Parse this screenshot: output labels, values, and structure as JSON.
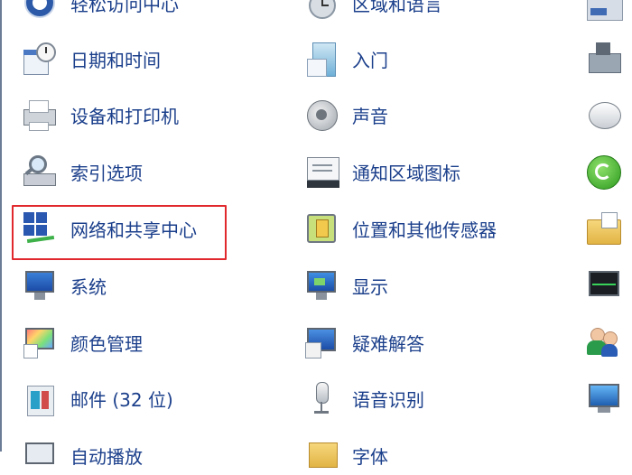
{
  "control_panel": {
    "items": [
      {
        "label": "轻松访问中心",
        "icon": "ease-of-access-icon"
      },
      {
        "label": "区域和语言",
        "icon": "region-language-icon"
      },
      {
        "label": "",
        "icon": "partial-icon-row0"
      },
      {
        "label": "日期和时间",
        "icon": "date-time-icon"
      },
      {
        "label": "入门",
        "icon": "getting-started-icon"
      },
      {
        "label": "",
        "icon": "partial-icon-row1"
      },
      {
        "label": "设备和打印机",
        "icon": "devices-printers-icon"
      },
      {
        "label": "声音",
        "icon": "sound-icon"
      },
      {
        "label": "",
        "icon": "mouse-icon"
      },
      {
        "label": "索引选项",
        "icon": "indexing-options-icon"
      },
      {
        "label": "通知区域图标",
        "icon": "notification-area-icon"
      },
      {
        "label": "",
        "icon": "sync-center-icon"
      },
      {
        "label": "网络和共享中心",
        "icon": "network-sharing-icon"
      },
      {
        "label": "位置和其他传感器",
        "icon": "location-sensors-icon"
      },
      {
        "label": "",
        "icon": "folder-options-icon"
      },
      {
        "label": "系统",
        "icon": "system-icon"
      },
      {
        "label": "显示",
        "icon": "display-icon"
      },
      {
        "label": "",
        "icon": "performance-icon"
      },
      {
        "label": "颜色管理",
        "icon": "color-management-icon"
      },
      {
        "label": "疑难解答",
        "icon": "troubleshooting-icon"
      },
      {
        "label": "",
        "icon": "user-accounts-icon"
      },
      {
        "label": "邮件 (32 位)",
        "icon": "mail-icon"
      },
      {
        "label": "语音识别",
        "icon": "speech-recognition-icon"
      },
      {
        "label": "",
        "icon": "desktop-gadgets-icon"
      },
      {
        "label": "自动播放",
        "icon": "autoplay-icon"
      },
      {
        "label": "字体",
        "icon": "fonts-icon"
      }
    ]
  },
  "colors": {
    "link_text": "#1b3f8b",
    "highlight_border": "#e0282d"
  }
}
